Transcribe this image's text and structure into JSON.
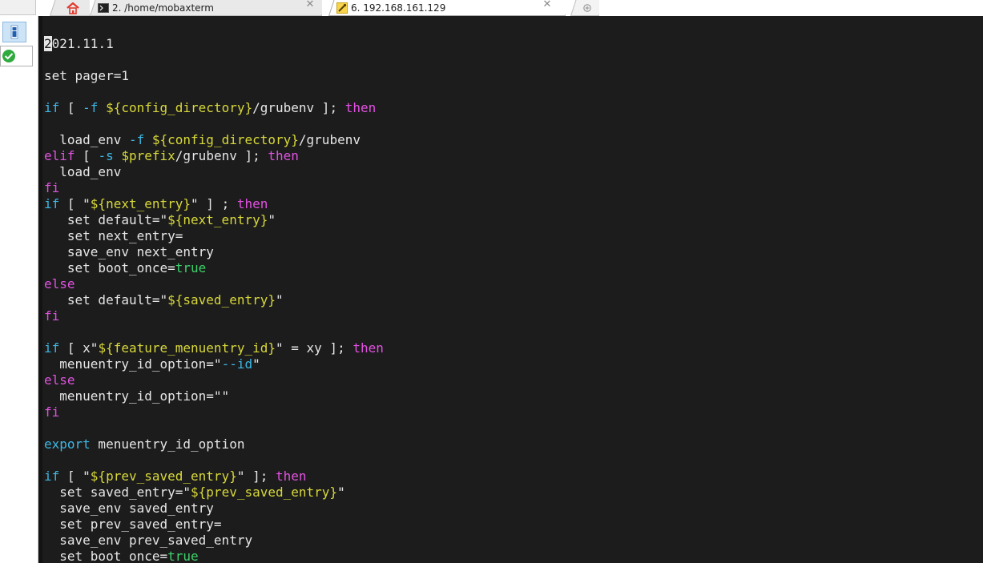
{
  "tabs": [
    {
      "id": "home",
      "label": "",
      "icon": "home-icon",
      "active": false,
      "closable": false
    },
    {
      "id": "mobaxterm",
      "label": "2. /home/mobaxterm",
      "icon": "terminal-icon",
      "active": false,
      "closable": true
    },
    {
      "id": "ssh",
      "label": "6. 192.168.161.129",
      "icon": "ssh-session-icon",
      "active": true,
      "closable": true
    },
    {
      "id": "new",
      "label": "",
      "icon": "new-tab-icon",
      "active": false,
      "closable": false
    }
  ],
  "close_glyph": "✕",
  "sidebar": {
    "items": [
      {
        "icon": "session-panel-icon"
      },
      {
        "icon": "check-circle-icon"
      }
    ]
  },
  "colors": {
    "terminal_bg": "#1c1c1c",
    "text": "#e6e6e6",
    "keyword": "#e152e1",
    "command": "#3db7e4",
    "variable": "#d8d83a",
    "boolean": "#3ed16a",
    "accent_home": "#e03a2e"
  },
  "terminal": {
    "lines": [
      [
        {
          "t": "2",
          "c": "cursor"
        },
        {
          "t": "021.11.1",
          "c": "white"
        }
      ],
      [],
      [
        {
          "t": "set pager=1",
          "c": "white"
        }
      ],
      [],
      [
        {
          "t": "if",
          "c": "cyan"
        },
        {
          "t": " [ ",
          "c": "white"
        },
        {
          "t": "-f",
          "c": "cyan"
        },
        {
          "t": " ",
          "c": "white"
        },
        {
          "t": "${config_directory}",
          "c": "yellow"
        },
        {
          "t": "/grubenv ]; ",
          "c": "white"
        },
        {
          "t": "then",
          "c": "magenta"
        }
      ],
      [],
      [
        {
          "t": "  load_env ",
          "c": "white"
        },
        {
          "t": "-f",
          "c": "cyan"
        },
        {
          "t": " ",
          "c": "white"
        },
        {
          "t": "${config_directory}",
          "c": "yellow"
        },
        {
          "t": "/grubenv",
          "c": "white"
        }
      ],
      [
        {
          "t": "elif",
          "c": "magenta"
        },
        {
          "t": " [ ",
          "c": "white"
        },
        {
          "t": "-s",
          "c": "cyan"
        },
        {
          "t": " ",
          "c": "white"
        },
        {
          "t": "$prefix",
          "c": "yellow"
        },
        {
          "t": "/grubenv ]; ",
          "c": "white"
        },
        {
          "t": "then",
          "c": "magenta"
        }
      ],
      [
        {
          "t": "  load_env",
          "c": "white"
        }
      ],
      [
        {
          "t": "fi",
          "c": "magenta"
        }
      ],
      [
        {
          "t": "if",
          "c": "cyan"
        },
        {
          "t": " [ \"",
          "c": "white"
        },
        {
          "t": "${next_entry}",
          "c": "yellow"
        },
        {
          "t": "\" ] ; ",
          "c": "white"
        },
        {
          "t": "then",
          "c": "magenta"
        }
      ],
      [
        {
          "t": "   set default=\"",
          "c": "white"
        },
        {
          "t": "${next_entry}",
          "c": "yellow"
        },
        {
          "t": "\"",
          "c": "white"
        }
      ],
      [
        {
          "t": "   set next_entry=",
          "c": "white"
        }
      ],
      [
        {
          "t": "   save_env next_entry",
          "c": "white"
        }
      ],
      [
        {
          "t": "   set boot_once=",
          "c": "white"
        },
        {
          "t": "true",
          "c": "green"
        }
      ],
      [
        {
          "t": "else",
          "c": "magenta"
        }
      ],
      [
        {
          "t": "   set default=\"",
          "c": "white"
        },
        {
          "t": "${saved_entry}",
          "c": "yellow"
        },
        {
          "t": "\"",
          "c": "white"
        }
      ],
      [
        {
          "t": "fi",
          "c": "magenta"
        }
      ],
      [],
      [
        {
          "t": "if",
          "c": "cyan"
        },
        {
          "t": " [ x\"",
          "c": "white"
        },
        {
          "t": "${feature_menuentry_id}",
          "c": "yellow"
        },
        {
          "t": "\" = xy ]; ",
          "c": "white"
        },
        {
          "t": "then",
          "c": "magenta"
        }
      ],
      [
        {
          "t": "  menuentry_id_option=\"",
          "c": "white"
        },
        {
          "t": "--id",
          "c": "cyan"
        },
        {
          "t": "\"",
          "c": "white"
        }
      ],
      [
        {
          "t": "else",
          "c": "magenta"
        }
      ],
      [
        {
          "t": "  menuentry_id_option=\"\"",
          "c": "white"
        }
      ],
      [
        {
          "t": "fi",
          "c": "magenta"
        }
      ],
      [],
      [
        {
          "t": "export",
          "c": "cyan"
        },
        {
          "t": " menuentry_id_option",
          "c": "white"
        }
      ],
      [],
      [
        {
          "t": "if",
          "c": "cyan"
        },
        {
          "t": " [ \"",
          "c": "white"
        },
        {
          "t": "${prev_saved_entry}",
          "c": "yellow"
        },
        {
          "t": "\" ]; ",
          "c": "white"
        },
        {
          "t": "then",
          "c": "magenta"
        }
      ],
      [
        {
          "t": "  set saved_entry=\"",
          "c": "white"
        },
        {
          "t": "${prev_saved_entry}",
          "c": "yellow"
        },
        {
          "t": "\"",
          "c": "white"
        }
      ],
      [
        {
          "t": "  save_env saved_entry",
          "c": "white"
        }
      ],
      [
        {
          "t": "  set prev_saved_entry=",
          "c": "white"
        }
      ],
      [
        {
          "t": "  save_env prev_saved_entry",
          "c": "white"
        }
      ],
      [
        {
          "t": "  set boot_once=",
          "c": "white"
        },
        {
          "t": "true",
          "c": "green"
        }
      ]
    ]
  }
}
